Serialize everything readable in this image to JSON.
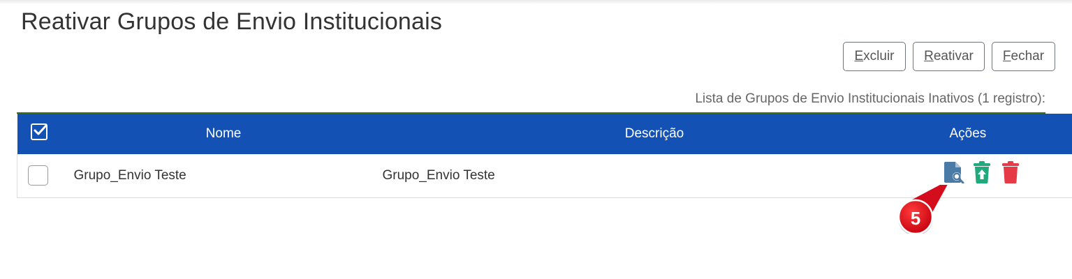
{
  "page": {
    "title": "Reativar Grupos de Envio Institucionais"
  },
  "toolbar": {
    "excluir": {
      "first": "E",
      "rest": "xcluir"
    },
    "reativar": {
      "first": "R",
      "rest": "eativar"
    },
    "fechar": {
      "first": "F",
      "rest": "echar"
    }
  },
  "table": {
    "caption": "Lista de Grupos de Envio Institucionais Inativos (1 registro):",
    "headers": {
      "nome": "Nome",
      "descricao": "Descrição",
      "acoes": "Ações"
    },
    "rows": [
      {
        "nome": "Grupo_Envio Teste",
        "descricao": "Grupo_Envio Teste",
        "actions": [
          "view-document-icon",
          "reactivate-icon",
          "delete-icon"
        ]
      }
    ]
  },
  "annotation": {
    "step_number": "5"
  },
  "colors": {
    "header_blue": "#1351b4",
    "view_icon": "#4a7aa6",
    "reactivate_icon": "#20a97a",
    "delete_icon": "#e63b47",
    "callout_red": "#e8001c"
  }
}
